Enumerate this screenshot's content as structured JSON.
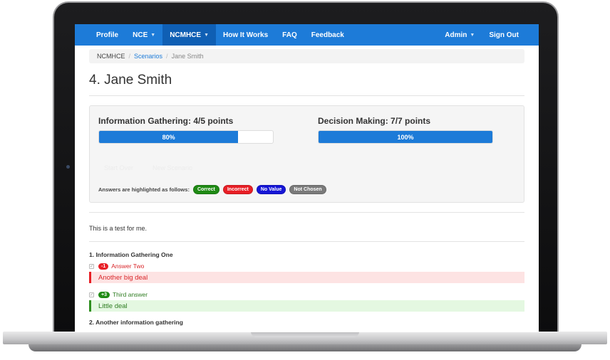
{
  "navbar": {
    "items": [
      {
        "label": "Profile",
        "dropdown": false,
        "active": false
      },
      {
        "label": "NCE",
        "dropdown": true,
        "active": false
      },
      {
        "label": "NCMHCE",
        "dropdown": true,
        "active": true
      },
      {
        "label": "How It Works",
        "dropdown": false,
        "active": false
      },
      {
        "label": "FAQ",
        "dropdown": false,
        "active": false
      },
      {
        "label": "Feedback",
        "dropdown": false,
        "active": false
      }
    ],
    "right_items": [
      {
        "label": "Admin",
        "dropdown": true
      },
      {
        "label": "Sign Out",
        "dropdown": false
      }
    ],
    "color": "#1d7bd8"
  },
  "breadcrumb": {
    "root": "NCMHCE",
    "link": "Scenarios",
    "current": "Jane Smith"
  },
  "page_title": "4. Jane Smith",
  "scores": {
    "info": {
      "label": "Information Gathering: 4/5 points",
      "percent_text": "80%",
      "fraction": 0.8
    },
    "decision": {
      "label": "Decision Making: 7/7 points",
      "percent_text": "100%",
      "fraction": 1.0
    }
  },
  "actions": {
    "start_over": "Start Over",
    "new_scenario": "New Scenario"
  },
  "legend": {
    "label": "Answers are highlighted as follows:",
    "items": [
      {
        "label": "Correct",
        "color": "#1f8a14"
      },
      {
        "label": "Incorrect",
        "color": "#e81f26"
      },
      {
        "label": "No Value",
        "color": "#1616d6"
      },
      {
        "label": "Not Chosen",
        "color": "#7a7a7a"
      }
    ]
  },
  "description": "This is a test for me.",
  "questions": [
    {
      "title": "1. Information Gathering One",
      "answers": [
        {
          "badge": "-1",
          "label": "Answer Two",
          "feedback": "Another big deal",
          "status": "incorrect"
        },
        {
          "badge": "+3",
          "label": "Third answer",
          "feedback": "Little deal",
          "status": "correct"
        }
      ]
    }
  ],
  "next_question_partial": "2. Another information gathering"
}
